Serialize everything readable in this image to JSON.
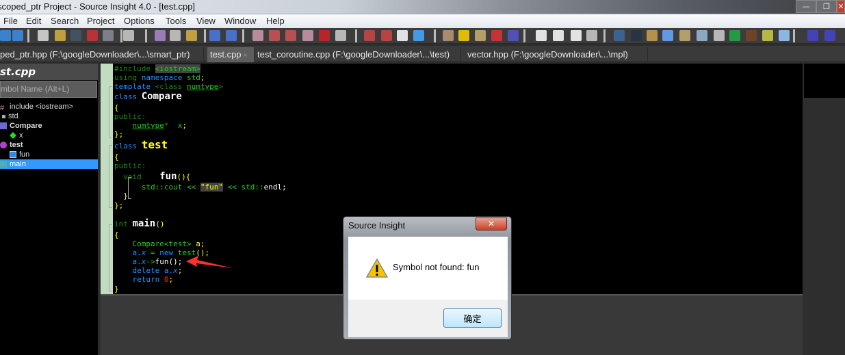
{
  "window": {
    "title": "scoped_ptr Project - Source Insight 4.0 - [test.cpp]",
    "controls": [
      "—",
      "❐",
      "✕"
    ]
  },
  "menu": [
    "File",
    "Edit",
    "Search",
    "Project",
    "Options",
    "Tools",
    "View",
    "Window",
    "Help"
  ],
  "tabs": [
    {
      "label": "ped_ptr.hpp (F:\\googleDownloader\\...\\smart_ptr)"
    },
    {
      "label": "test.cpp",
      "active": true,
      "close": "×"
    },
    {
      "label": "test_coroutine.cpp (F:\\googleDownloader\\...\\test)"
    },
    {
      "label": "vector.hpp (F:\\googleDownloader\\...\\mpl)"
    }
  ],
  "symbol_panel": {
    "file": "st.cpp",
    "search_placeholder": "mbol Name (Alt+L)",
    "items": [
      {
        "label": "include <iostream>",
        "icon": "hash-icon"
      },
      {
        "label": "std",
        "icon": "namespace-icon"
      },
      {
        "label": "Compare",
        "icon": "class-icon"
      },
      {
        "label": "x",
        "icon": "member-icon"
      },
      {
        "label": "test",
        "icon": "class-icon"
      },
      {
        "label": "fun",
        "icon": "method-icon"
      },
      {
        "label": "main",
        "icon": "function-icon",
        "selected": true
      }
    ]
  },
  "code": {
    "l1a": "#include ",
    "l1b": "<iostream>",
    "l2a": "using ",
    "l2b": "namespace ",
    "l2c": "std",
    "l2d": ";",
    "l3a": "template ",
    "l3b": "<class ",
    "l3c": "numtype",
    "l3d": ">",
    "l4a": "class ",
    "l4b": "Compare",
    "ob": "{",
    "pub": "public:",
    "l7a": "    ",
    "l7b": "numtype",
    "l7c": "*  ",
    "l7d": "x",
    "l7e": ";",
    "cb": "};",
    "l9b": "test",
    "l12a": "  void    ",
    "l12b": "fun",
    "l12c": "(){",
    "l13a": "      std::cout << ",
    "l13b": "\"fun\"",
    "l13c": " << std::",
    "l13d": "endl;",
    "l14": "  }",
    "l17a": "int ",
    "l17b": "main",
    "l17c": "()",
    "l19a": "    Compare<test> ",
    "l19b": "a;",
    "l20a": "    a.",
    "l20b": "x",
    "l20c": " = ",
    "l20d": "new ",
    "l20e": "test",
    "l20f": "();",
    "l21a": "    a.",
    "l21b": "x",
    "l21c": "->",
    "l21d": "fun();",
    "l22a": "    delete ",
    "l22b": "a.",
    "l22c": "x",
    "l22d": ";",
    "l23a": "    return ",
    "l23b": "0",
    "l23c": ";",
    "l24": "}"
  },
  "dialog": {
    "title": "Source Insight",
    "close": "✕",
    "message": "Symbol not found: fun",
    "ok": "确定",
    "icon": "warning-icon"
  },
  "colors": {
    "keyword": "#1e90ff",
    "identifier": "#22cc22",
    "class_name": "#ffff00",
    "selection": "#3399ff",
    "gutter": "#c2dcc0"
  }
}
